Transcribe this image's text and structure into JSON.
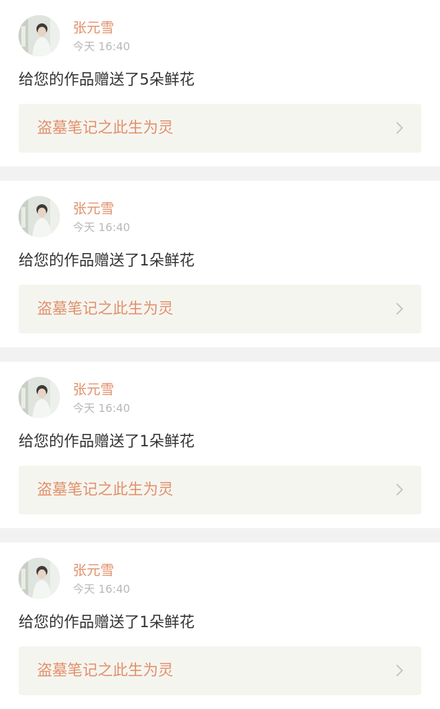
{
  "notifications": [
    {
      "user_name": "张元雪",
      "time": "今天 16:40",
      "message": "给您的作品赠送了5朵鲜花",
      "work_title": "盗墓笔记之此生为灵"
    },
    {
      "user_name": "张元雪",
      "time": "今天 16:40",
      "message": "给您的作品赠送了1朵鲜花",
      "work_title": "盗墓笔记之此生为灵"
    },
    {
      "user_name": "张元雪",
      "time": "今天 16:40",
      "message": "给您的作品赠送了1朵鲜花",
      "work_title": "盗墓笔记之此生为灵"
    },
    {
      "user_name": "张元雪",
      "time": "今天 16:40",
      "message": "给您的作品赠送了1朵鲜花",
      "work_title": "盗墓笔记之此生为灵"
    }
  ],
  "icons": {
    "avatar": "avatar-photo",
    "link_arrow": "chevron-right-icon"
  },
  "colors": {
    "accent": "#e2906a",
    "message_text": "#333333",
    "time_text": "#b8b8b8",
    "link_card_bg": "#f5f5f0",
    "divider": "#f2f2f2"
  }
}
